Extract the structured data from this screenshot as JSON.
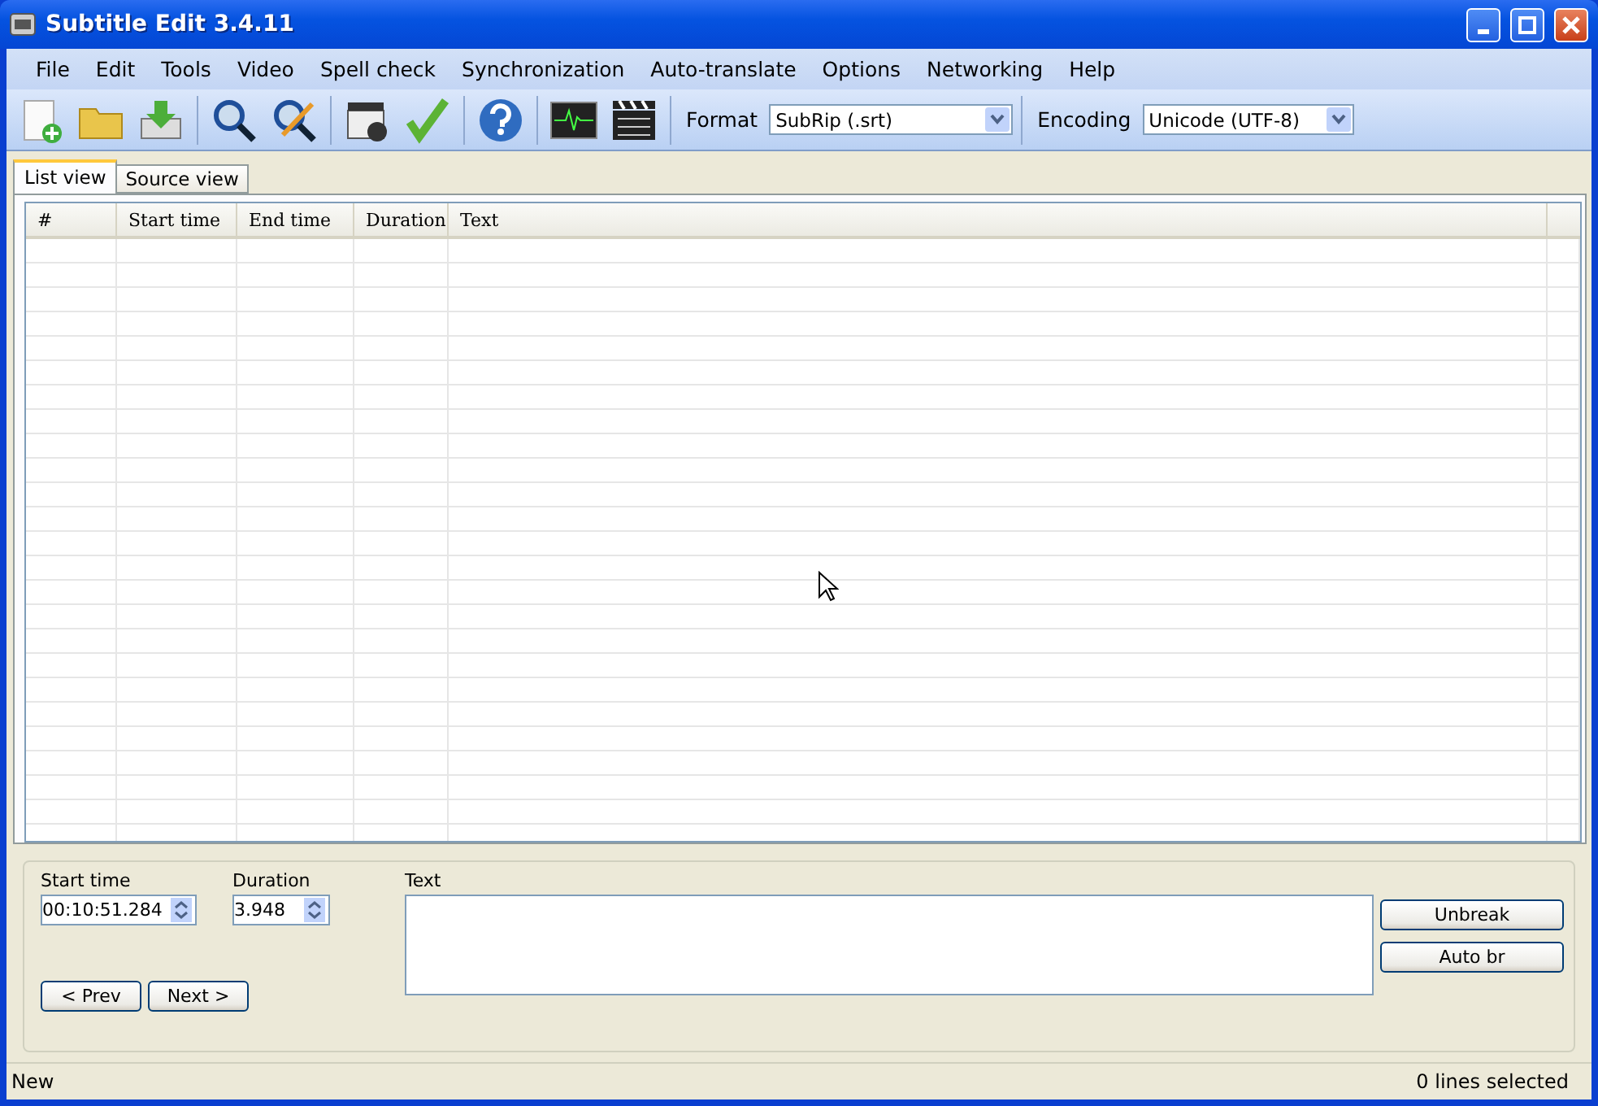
{
  "window": {
    "title": "Subtitle Edit 3.4.11"
  },
  "menu": [
    "File",
    "Edit",
    "Tools",
    "Video",
    "Spell check",
    "Synchronization",
    "Auto-translate",
    "Options",
    "Networking",
    "Help"
  ],
  "toolbar": {
    "format_label": "Format",
    "format_value": "SubRip (.srt)",
    "encoding_label": "Encoding",
    "encoding_value": "Unicode (UTF-8)"
  },
  "tabs": [
    {
      "label": "List view",
      "selected": true
    },
    {
      "label": "Source view",
      "selected": false
    }
  ],
  "table": {
    "columns": [
      "#",
      "Start time",
      "End time",
      "Duration",
      "Text"
    ]
  },
  "editor": {
    "start_time_label": "Start time",
    "start_time": "00:10:51.284",
    "duration_label": "Duration",
    "duration": "3.948",
    "text_label": "Text",
    "prev_button": "< Prev",
    "next_button": "Next >",
    "side_buttons": [
      "Unbreak",
      "Auto br"
    ]
  },
  "status_bar": {
    "left": "New",
    "right": "0 lines selected"
  }
}
